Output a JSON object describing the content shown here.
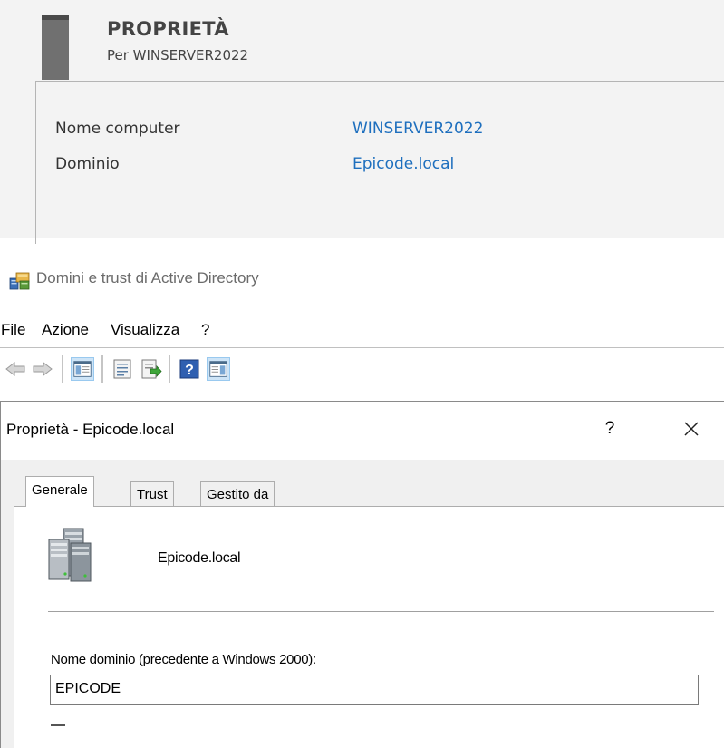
{
  "server_properties": {
    "title": "PROPRIETÀ",
    "subtitle": "Per WINSERVER2022",
    "rows": [
      {
        "label": "Nome computer",
        "value": "WINSERVER2022"
      },
      {
        "label": "Dominio",
        "value": "Epicode.local"
      }
    ]
  },
  "app": {
    "title": "Domini e trust di Active Directory",
    "menu": [
      "File",
      "Azione",
      "Visualizza",
      "?"
    ],
    "toolbar": {
      "icons": [
        "back-icon",
        "forward-icon",
        "show-console-tree-icon",
        "properties-icon",
        "export-list-icon",
        "help-icon",
        "show-action-pane-icon"
      ]
    }
  },
  "dialog": {
    "title": "Proprietà - Epicode.local",
    "help_label": "?",
    "tabs": [
      "Generale",
      "Trust",
      "Gestito da"
    ],
    "active_tab": "Generale",
    "domain_name": "Epicode.local",
    "netbios_label": "Nome dominio (precedente a Windows 2000):",
    "netbios_value": "EPICODE"
  },
  "colors": {
    "link": "#1e6fbe",
    "panel_bg": "#f3f3f3",
    "active_tab_bg": "#ffffff"
  }
}
